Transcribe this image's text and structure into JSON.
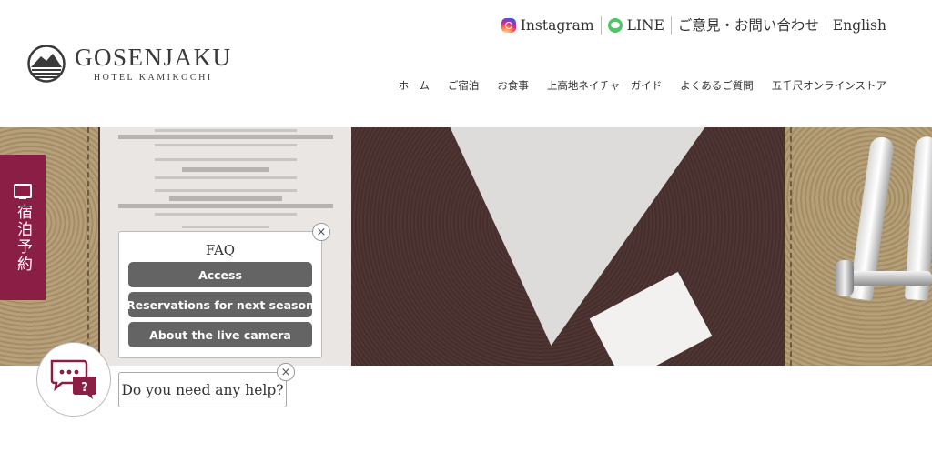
{
  "brand": {
    "name": "GOSENJAKU",
    "subtitle": "HOTEL KAMIKOCHI"
  },
  "top_links": [
    {
      "label": "Instagram",
      "icon": "instagram-icon"
    },
    {
      "label": "LINE",
      "icon": "line-icon"
    },
    {
      "label": "ご意見・お問い合わせ"
    },
    {
      "label": "English"
    }
  ],
  "main_nav": [
    "ホーム",
    "ご宿泊",
    "お食事",
    "上高地ネイチャーガイド",
    "よくあるご質問",
    "五千尺オンラインストア"
  ],
  "reservation_tab": {
    "label": "宿泊予約",
    "icon": "monitor-icon",
    "color": "#8a1e44"
  },
  "faq_popup": {
    "title": "FAQ",
    "buttons": [
      "Access",
      "Reservations for next season",
      "About the live camera"
    ],
    "close_symbol": "×"
  },
  "chat": {
    "icon": "chat-bubbles-icon",
    "badge": "?",
    "help_text": "Do you need any help?",
    "close_symbol": "×",
    "accent": "#8a1e44"
  },
  "colors": {
    "accent": "#8a1e44",
    "faq_button": "#646464"
  }
}
